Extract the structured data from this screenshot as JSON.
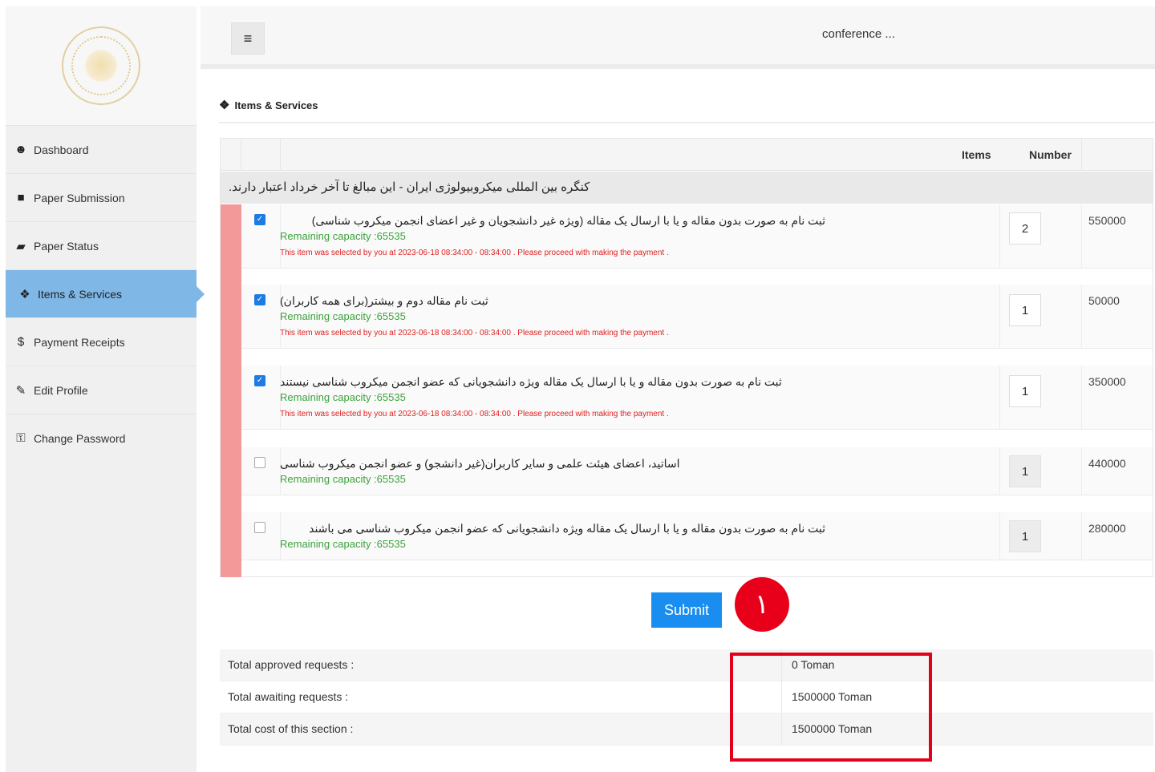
{
  "header": {
    "title": "conference ...",
    "menu_icon": "hamburger-icon"
  },
  "sidebar": {
    "items": [
      {
        "label": "Dashboard",
        "icon": "user-icon",
        "glyph": "☻",
        "active": false
      },
      {
        "label": "Paper Submission",
        "icon": "file-icon",
        "glyph": "■",
        "active": false
      },
      {
        "label": "Paper Status",
        "icon": "folder-open-icon",
        "glyph": "▰",
        "active": false
      },
      {
        "label": "Items & Services",
        "icon": "cubes-icon",
        "glyph": "❖",
        "active": true
      },
      {
        "label": "Payment Receipts",
        "icon": "dollar-icon",
        "glyph": "$",
        "active": false
      },
      {
        "label": "Edit Profile",
        "icon": "edit-icon",
        "glyph": "✎",
        "active": false
      },
      {
        "label": "Change Password",
        "icon": "unlock-icon",
        "glyph": "⚿",
        "active": false
      }
    ]
  },
  "section": {
    "title": "Items & Services",
    "icon": "cubes-icon"
  },
  "table": {
    "col_items": "Items",
    "col_number": "Number",
    "group_title": "کنگره بین المللی میکروبیولوژی ایران - این مبالغ تا آخر خرداد اعتبار دارند.",
    "rows": [
      {
        "title": "ثبت نام به صورت بدون مقاله و یا با ارسال یک مقاله (ویژه غیر دانشجویان و غیر اعضای انجمن میکروب شناسی)",
        "capacity": "Remaining capacity :65535",
        "notice": "This item was selected by you at 2023-06-18 08:34:00 - 08:34:00 . Please proceed with making the payment .",
        "checked": true,
        "quantity": "2",
        "price": "550000"
      },
      {
        "title": "ثبت نام مقاله دوم و بیشتر(برای همه کاربران)",
        "capacity": "Remaining capacity :65535",
        "notice": "This item was selected by you at 2023-06-18 08:34:00 - 08:34:00 . Please proceed with making the payment .",
        "checked": true,
        "quantity": "1",
        "price": "50000"
      },
      {
        "title": "ثبت نام به صورت بدون مقاله و یا با ارسال یک مقاله ویژه دانشجویانی که عضو انجمن میکروب شناسی نیستند",
        "capacity": "Remaining capacity :65535",
        "notice": "This item was selected by you at 2023-06-18 08:34:00 - 08:34:00 . Please proceed with making the payment .",
        "checked": true,
        "quantity": "1",
        "price": "350000"
      },
      {
        "title": "اساتید، اعضای هیئت علمی و سایر کاربران(غیر دانشجو) و عضو انجمن میکروب شناسی",
        "capacity": "Remaining capacity :65535",
        "notice": "",
        "checked": false,
        "quantity": "1",
        "price": "440000"
      },
      {
        "title": "ثبت نام به صورت بدون مقاله و یا با ارسال یک مقاله ویژه دانشجویانی که عضو انجمن میکروب شناسی می باشند",
        "capacity": "Remaining capacity :65535",
        "notice": "",
        "checked": false,
        "quantity": "1",
        "price": "280000"
      }
    ]
  },
  "submit_label": "Submit",
  "step_badge": "١",
  "totals": [
    {
      "label": "Total approved requests :",
      "value": "0 Toman"
    },
    {
      "label": "Total awaiting requests :",
      "value": "1500000 Toman"
    },
    {
      "label": "Total cost of this section :",
      "value": "1500000 Toman"
    }
  ],
  "colors": {
    "accent": "#1a8ef0",
    "active_nav": "#7fb7e6",
    "capacity_text": "#3ca23c",
    "notice_text": "#e02020",
    "highlight": "#e3001b",
    "row_marker": "#f4999a"
  }
}
